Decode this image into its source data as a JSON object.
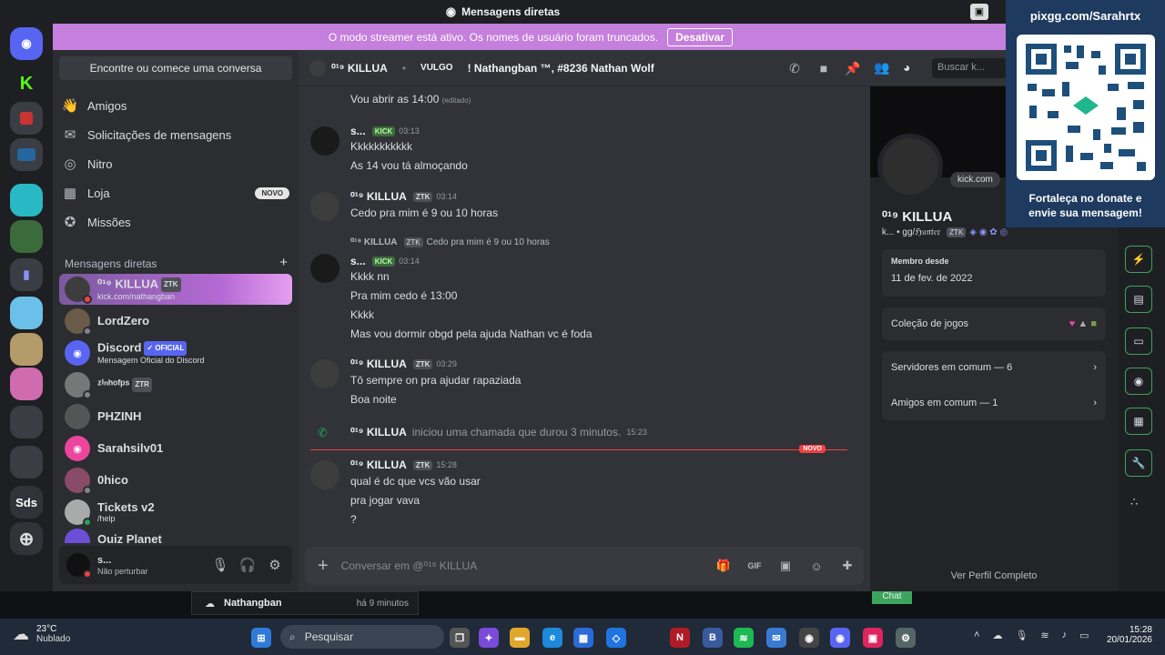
{
  "window": {
    "title": "Mensagens diretas"
  },
  "streamer_banner": {
    "text": "O modo streamer está ativo. Os nomes de usuário foram truncados.",
    "button": "Desativar"
  },
  "servers": [
    "Sds"
  ],
  "sidebar": {
    "search_button": "Encontre ou comece uma conversa",
    "nav": [
      {
        "label": "Amigos",
        "icon": "friends-icon"
      },
      {
        "label": "Solicitações de mensagens",
        "icon": "envelope-icon"
      },
      {
        "label": "Nitro",
        "icon": "nitro-icon"
      },
      {
        "label": "Loja",
        "icon": "shop-icon",
        "badge": "NOVO"
      },
      {
        "label": "Missões",
        "icon": "quest-icon"
      }
    ],
    "dm_header": "Mensagens diretas",
    "dms": [
      {
        "name": "⁰¹⁹ KILLUA",
        "tag": "ZTK",
        "sub": "kick.com/nathangban",
        "color": "#3d3d3d"
      },
      {
        "name": "LordZero",
        "sub": "",
        "color": "#6a5a48"
      },
      {
        "name": "Discord",
        "tag": "✓ OFICIAL",
        "sub": "Mensagem Oficial do Discord",
        "color": "#5865f2"
      },
      {
        "name": "ᶻⁱⁿʰᵒᶠᵖˢ",
        "tag": "ZTR",
        "sub": "",
        "color": "#777"
      },
      {
        "name": "PHZINH",
        "sub": "",
        "color": "#555"
      },
      {
        "name": "Sarahsilv01",
        "sub": "",
        "color": "#eb459e"
      },
      {
        "name": "0hico",
        "sub": "",
        "color": "#8a4a6a"
      },
      {
        "name": "Tickets v2",
        "sub": "/help",
        "color": "#aaa"
      },
      {
        "name": "Quiz Planet",
        "sub": "",
        "color": "#6b4fd6"
      }
    ],
    "user": {
      "name": "s...",
      "status": "Não perturbar"
    }
  },
  "chat": {
    "header": {
      "name": "⁰¹⁹ KILLUA",
      "alias_label": "VULGO",
      "alias": "! Nathangban ™, #8236 Nathan Wolf",
      "search_placeholder": "Buscar k..."
    },
    "messages": [
      {
        "author": "",
        "time": "",
        "lines": [
          "Vou abrir as 14:00"
        ],
        "edited": "(editado)"
      },
      {
        "author": "s...",
        "tag": "KICK",
        "time": "03:13",
        "lines": [
          "Kkkkkkkkkkk",
          "As 14 vou tá almoçando"
        ]
      },
      {
        "author": "⁰¹⁹ KILLUA",
        "tag": "ZTK",
        "time": "03:14",
        "lines": [
          "Cedo pra mim é 9 ou 10 horas"
        ]
      },
      {
        "reply_author": "⁰¹⁹ KILLUA",
        "reply_tag": "ZTK",
        "reply_text": "Cedo pra mim é 9 ou 10 horas",
        "author": "s...",
        "tag": "KICK",
        "time": "03:14",
        "lines": [
          "Kkkk nn",
          "Pra mim cedo é 13:00",
          "Kkkk",
          "Mas vou dormir obgd pela ajuda  Nathan vc é foda"
        ]
      },
      {
        "author": "⁰¹⁹ KILLUA",
        "tag": "ZTK",
        "time": "03:29",
        "lines": [
          "Tô sempre on pra ajudar rapaziada",
          "Boa noite"
        ]
      },
      {
        "call_author": "⁰¹⁹ KILLUA",
        "call_text": "iniciou uma chamada que durou 3 minutos.",
        "time": "15:23"
      },
      {
        "author": "⁰¹⁹ KILLUA",
        "tag": "ZTK",
        "time": "15:28",
        "lines": [
          "qual é dc que vcs vão usar",
          "pra jogar vava",
          "?"
        ]
      }
    ],
    "new_badge": "NOVO",
    "composer_placeholder": "Conversar em @⁰¹⁹ KILLUA"
  },
  "profile": {
    "name": "⁰¹⁹ KILLUA",
    "handle": "k... • ɡɡ/ℌ𝔲𝔫𝔱𝔢𝔯",
    "tag": "ZTK",
    "activity": "kick.com",
    "member_since_label": "Membro desde",
    "member_since": "11 de fev. de 2022",
    "games_label": "Coleção de jogos",
    "mutual_servers": "Servidores em comum — 6",
    "mutual_friends": "Amigos em comum — 1",
    "view_full": "Ver Perfil Completo"
  },
  "donate": {
    "url": "pixgg.com/Sarahrtx",
    "message": "Fortaleça no donate e envie sua mensagem!"
  },
  "bottom_strip": {
    "name": "Nathangban",
    "time": "há 9 minutos",
    "chat": "Chat"
  },
  "taskbar": {
    "weather_temp": "23°C",
    "weather_desc": "Nublado",
    "search": "Pesquisar",
    "time": "15:28",
    "date": "20/01/2026"
  }
}
